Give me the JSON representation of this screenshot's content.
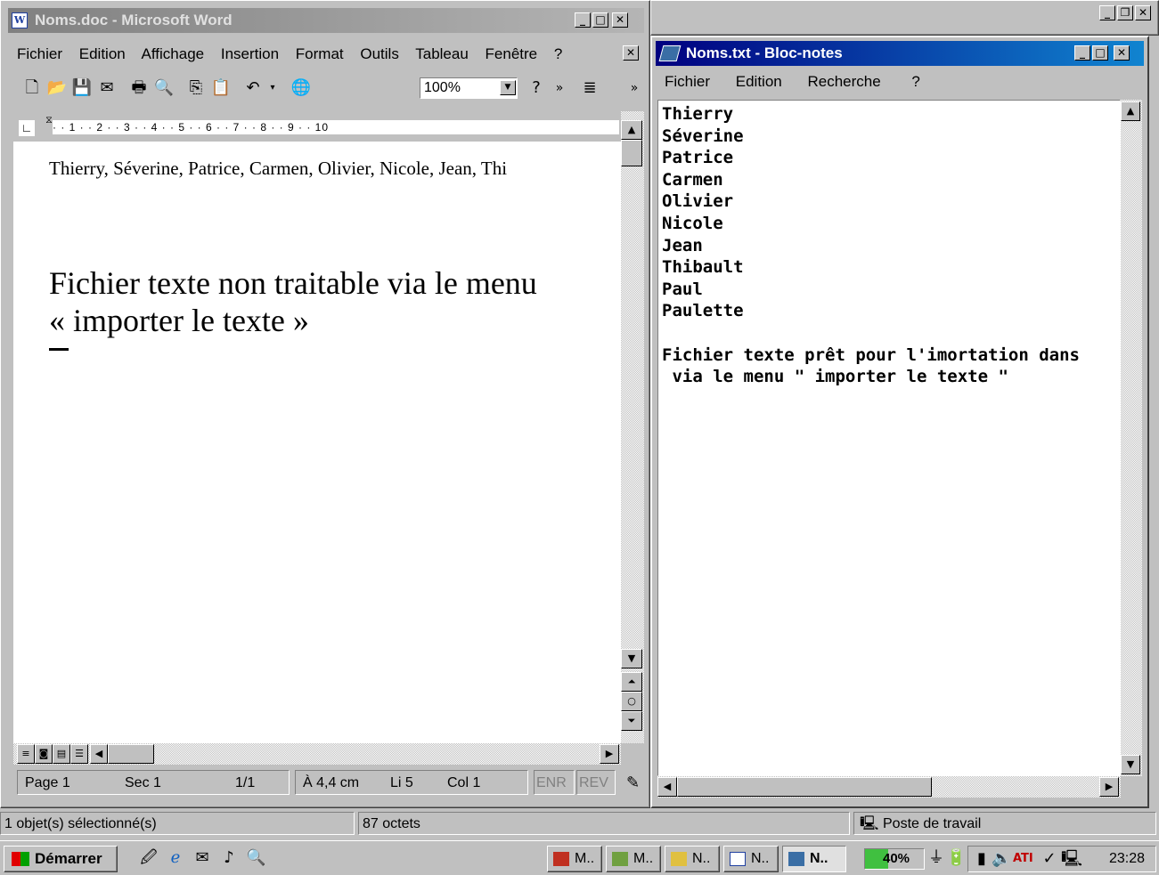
{
  "word": {
    "title": "Noms.doc - Microsoft Word",
    "menu": [
      "Fichier",
      "Edition",
      "Affichage",
      "Insertion",
      "Format",
      "Outils",
      "Tableau",
      "Fenêtre",
      "?"
    ],
    "zoom": "100%",
    "ruler_text": "·  ·  1  ·  ·  2  ·  ·  3  ·  ·  4  ·  ·  5  ·  ·  6  ·  ·  7  ·  ·  8  ·  ·  9  ·  ·  10",
    "doc_line1": "Thierry, Séverine, Patrice, Carmen, Olivier, Nicole, Jean, Thi",
    "doc_line2": "Fichier texte non traitable via le menu",
    "doc_line3": " « importer le texte »",
    "status": {
      "page": "Page  1",
      "sec": "Sec  1",
      "pages": "1/1",
      "pos": "À  4,4 cm",
      "line": "Li 5",
      "col": "Col  1",
      "enr": "ENR",
      "rev": "REV"
    }
  },
  "notepad": {
    "title": "Noms.txt - Bloc-notes",
    "menu": [
      "Fichier",
      "Edition",
      "Recherche",
      "?"
    ],
    "content": "Thierry\nSéverine\nPatrice\nCarmen\nOlivier\nNicole\nJean\nThibault\nPaul\nPaulette\n\nFichier texte prêt pour l'imortation dans\n via le menu \" importer le texte \""
  },
  "explorer_status": {
    "selected": "1 objet(s) sélectionné(s)",
    "size": "87 octets",
    "location": "Poste de travail"
  },
  "taskbar": {
    "start_label": "Démarrer",
    "tasks": [
      "M..",
      "M..",
      "N..",
      "N..",
      "N.."
    ],
    "battery": "40%",
    "clock": "23:28"
  }
}
